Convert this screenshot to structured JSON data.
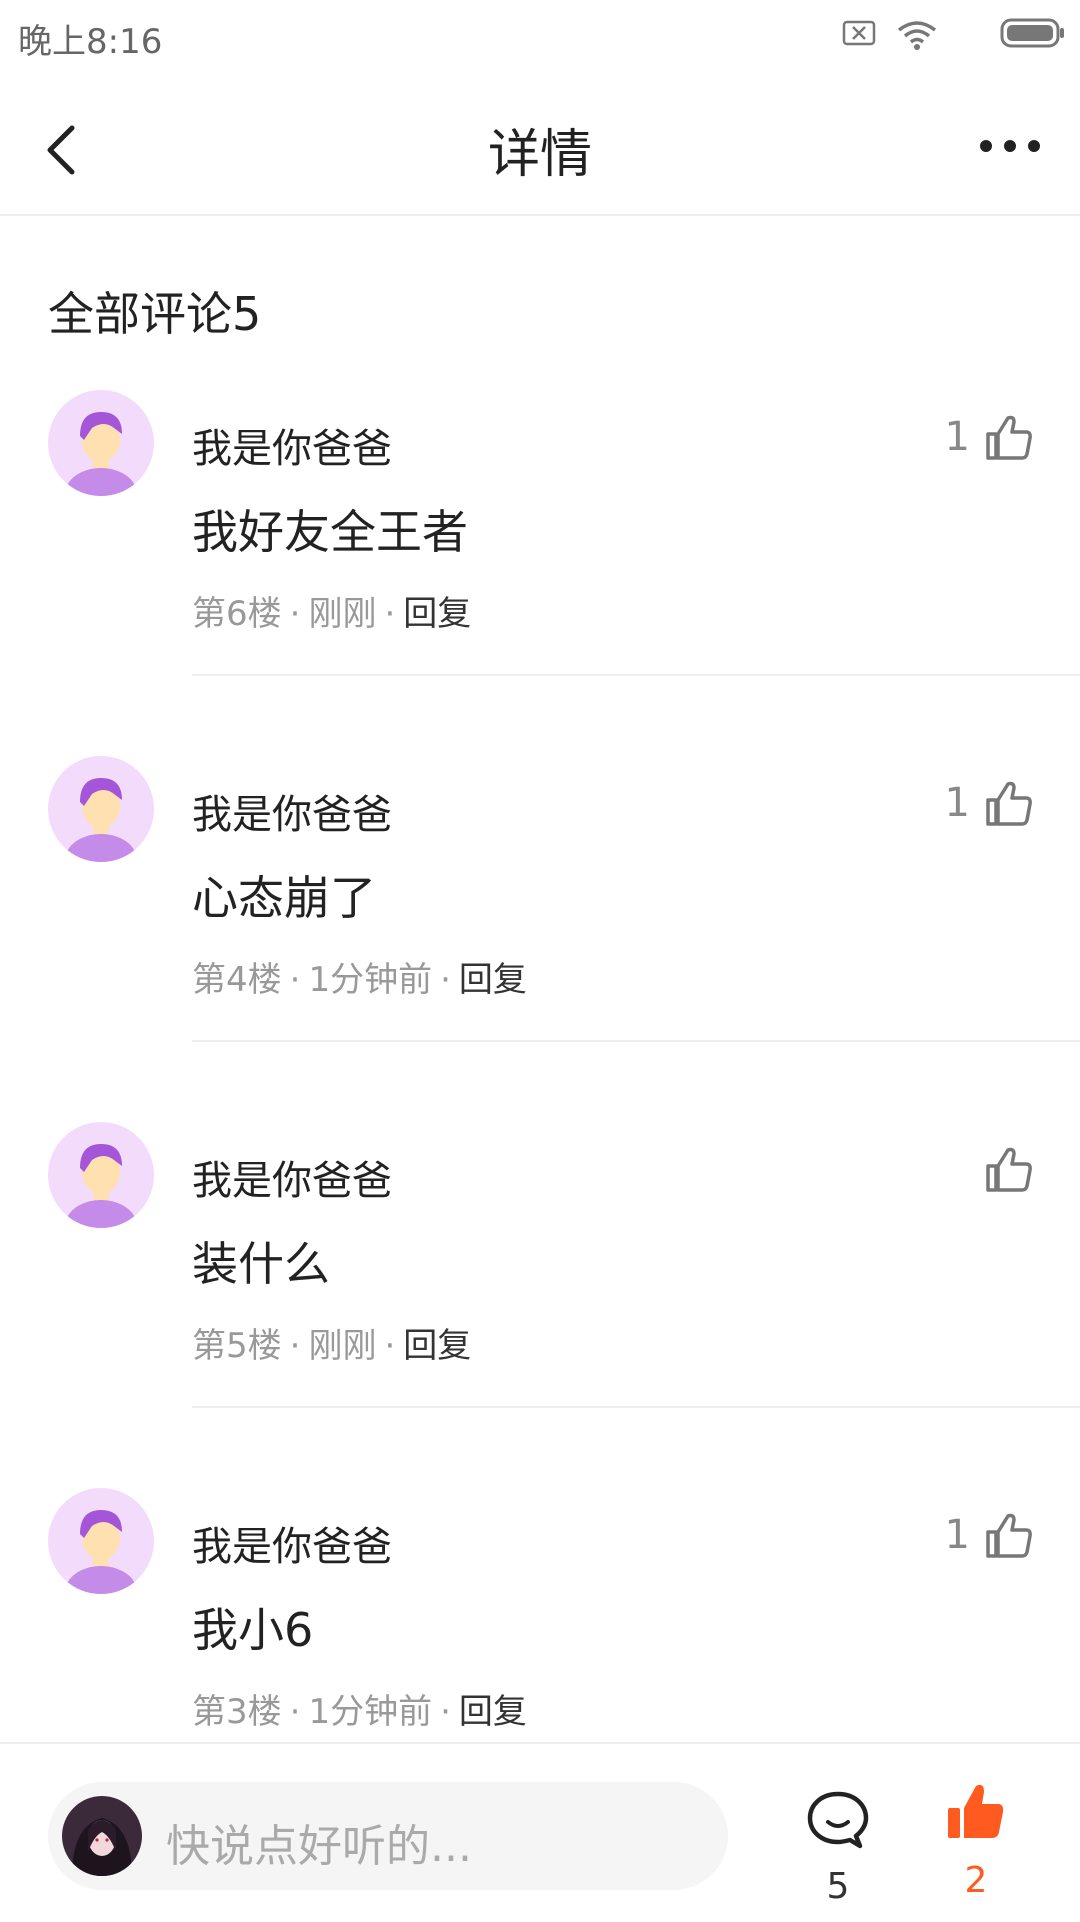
{
  "status_bar": {
    "time": "晚上8:16",
    "icons": [
      "sim-x-icon",
      "wifi-icon",
      "battery-icon"
    ]
  },
  "nav": {
    "title": "详情",
    "back_icon": "chevron-left-icon",
    "more_icon": "more-dots-icon"
  },
  "section": {
    "title": "全部评论5"
  },
  "comments": [
    {
      "user": "我是你爸爸",
      "text": "我好友全王者",
      "floor": "第6楼",
      "time": "刚刚",
      "reply": "回复",
      "likes": "1",
      "sep": "·"
    },
    {
      "user": "我是你爸爸",
      "text": "心态崩了",
      "floor": "第4楼",
      "time": "1分钟前",
      "reply": "回复",
      "likes": "1",
      "sep": "·"
    },
    {
      "user": "我是你爸爸",
      "text": "装什么",
      "floor": "第5楼",
      "time": "刚刚",
      "reply": "回复",
      "likes": "",
      "sep": "·"
    },
    {
      "user": "我是你爸爸",
      "text": "我小6",
      "floor": "第3楼",
      "time": "1分钟前",
      "reply": "回复",
      "likes": "1",
      "sep": "·"
    }
  ],
  "bottom": {
    "placeholder": "快说点好听的...",
    "comment_count": "5",
    "like_count": "2"
  },
  "colors": {
    "accent": "#ff5a1f",
    "avatar_bg": "#f3dcfb",
    "avatar_hair": "#a455d8",
    "avatar_skin": "#ffe0b0",
    "avatar_body": "#c58be8"
  }
}
